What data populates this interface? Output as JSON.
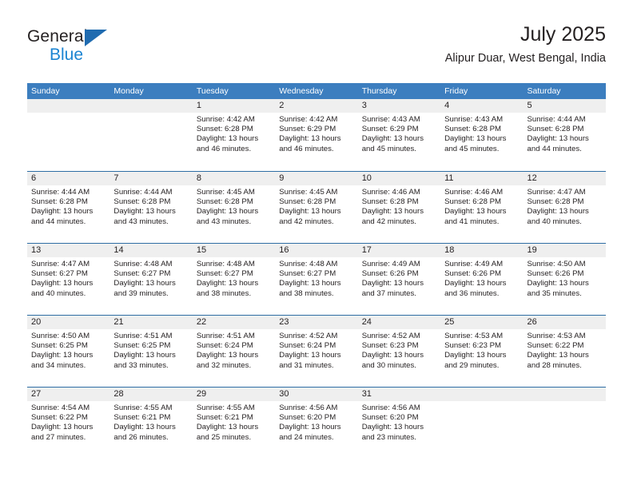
{
  "brand": {
    "name_top": "General",
    "name_bottom": "Blue"
  },
  "header": {
    "title": "July 2025",
    "subtitle": "Alipur Duar, West Bengal, India"
  },
  "calendar": {
    "weekdays": [
      "Sunday",
      "Monday",
      "Tuesday",
      "Wednesday",
      "Thursday",
      "Friday",
      "Saturday"
    ],
    "colors": {
      "header_blue": "#3c7ebf",
      "row_divider_blue": "#2e6da4",
      "day_band_gray": "#efefef",
      "brand_blue": "#1b84d2",
      "triangle_blue": "#1f6bb0",
      "text": "#231f20"
    },
    "weeks": [
      [
        {
          "day": "",
          "sunrise": "",
          "sunset": "",
          "daylight_1": "",
          "daylight_2": ""
        },
        {
          "day": "",
          "sunrise": "",
          "sunset": "",
          "daylight_1": "",
          "daylight_2": ""
        },
        {
          "day": "1",
          "sunrise": "Sunrise: 4:42 AM",
          "sunset": "Sunset: 6:28 PM",
          "daylight_1": "Daylight: 13 hours",
          "daylight_2": "and 46 minutes."
        },
        {
          "day": "2",
          "sunrise": "Sunrise: 4:42 AM",
          "sunset": "Sunset: 6:29 PM",
          "daylight_1": "Daylight: 13 hours",
          "daylight_2": "and 46 minutes."
        },
        {
          "day": "3",
          "sunrise": "Sunrise: 4:43 AM",
          "sunset": "Sunset: 6:29 PM",
          "daylight_1": "Daylight: 13 hours",
          "daylight_2": "and 45 minutes."
        },
        {
          "day": "4",
          "sunrise": "Sunrise: 4:43 AM",
          "sunset": "Sunset: 6:28 PM",
          "daylight_1": "Daylight: 13 hours",
          "daylight_2": "and 45 minutes."
        },
        {
          "day": "5",
          "sunrise": "Sunrise: 4:44 AM",
          "sunset": "Sunset: 6:28 PM",
          "daylight_1": "Daylight: 13 hours",
          "daylight_2": "and 44 minutes."
        }
      ],
      [
        {
          "day": "6",
          "sunrise": "Sunrise: 4:44 AM",
          "sunset": "Sunset: 6:28 PM",
          "daylight_1": "Daylight: 13 hours",
          "daylight_2": "and 44 minutes."
        },
        {
          "day": "7",
          "sunrise": "Sunrise: 4:44 AM",
          "sunset": "Sunset: 6:28 PM",
          "daylight_1": "Daylight: 13 hours",
          "daylight_2": "and 43 minutes."
        },
        {
          "day": "8",
          "sunrise": "Sunrise: 4:45 AM",
          "sunset": "Sunset: 6:28 PM",
          "daylight_1": "Daylight: 13 hours",
          "daylight_2": "and 43 minutes."
        },
        {
          "day": "9",
          "sunrise": "Sunrise: 4:45 AM",
          "sunset": "Sunset: 6:28 PM",
          "daylight_1": "Daylight: 13 hours",
          "daylight_2": "and 42 minutes."
        },
        {
          "day": "10",
          "sunrise": "Sunrise: 4:46 AM",
          "sunset": "Sunset: 6:28 PM",
          "daylight_1": "Daylight: 13 hours",
          "daylight_2": "and 42 minutes."
        },
        {
          "day": "11",
          "sunrise": "Sunrise: 4:46 AM",
          "sunset": "Sunset: 6:28 PM",
          "daylight_1": "Daylight: 13 hours",
          "daylight_2": "and 41 minutes."
        },
        {
          "day": "12",
          "sunrise": "Sunrise: 4:47 AM",
          "sunset": "Sunset: 6:28 PM",
          "daylight_1": "Daylight: 13 hours",
          "daylight_2": "and 40 minutes."
        }
      ],
      [
        {
          "day": "13",
          "sunrise": "Sunrise: 4:47 AM",
          "sunset": "Sunset: 6:27 PM",
          "daylight_1": "Daylight: 13 hours",
          "daylight_2": "and 40 minutes."
        },
        {
          "day": "14",
          "sunrise": "Sunrise: 4:48 AM",
          "sunset": "Sunset: 6:27 PM",
          "daylight_1": "Daylight: 13 hours",
          "daylight_2": "and 39 minutes."
        },
        {
          "day": "15",
          "sunrise": "Sunrise: 4:48 AM",
          "sunset": "Sunset: 6:27 PM",
          "daylight_1": "Daylight: 13 hours",
          "daylight_2": "and 38 minutes."
        },
        {
          "day": "16",
          "sunrise": "Sunrise: 4:48 AM",
          "sunset": "Sunset: 6:27 PM",
          "daylight_1": "Daylight: 13 hours",
          "daylight_2": "and 38 minutes."
        },
        {
          "day": "17",
          "sunrise": "Sunrise: 4:49 AM",
          "sunset": "Sunset: 6:26 PM",
          "daylight_1": "Daylight: 13 hours",
          "daylight_2": "and 37 minutes."
        },
        {
          "day": "18",
          "sunrise": "Sunrise: 4:49 AM",
          "sunset": "Sunset: 6:26 PM",
          "daylight_1": "Daylight: 13 hours",
          "daylight_2": "and 36 minutes."
        },
        {
          "day": "19",
          "sunrise": "Sunrise: 4:50 AM",
          "sunset": "Sunset: 6:26 PM",
          "daylight_1": "Daylight: 13 hours",
          "daylight_2": "and 35 minutes."
        }
      ],
      [
        {
          "day": "20",
          "sunrise": "Sunrise: 4:50 AM",
          "sunset": "Sunset: 6:25 PM",
          "daylight_1": "Daylight: 13 hours",
          "daylight_2": "and 34 minutes."
        },
        {
          "day": "21",
          "sunrise": "Sunrise: 4:51 AM",
          "sunset": "Sunset: 6:25 PM",
          "daylight_1": "Daylight: 13 hours",
          "daylight_2": "and 33 minutes."
        },
        {
          "day": "22",
          "sunrise": "Sunrise: 4:51 AM",
          "sunset": "Sunset: 6:24 PM",
          "daylight_1": "Daylight: 13 hours",
          "daylight_2": "and 32 minutes."
        },
        {
          "day": "23",
          "sunrise": "Sunrise: 4:52 AM",
          "sunset": "Sunset: 6:24 PM",
          "daylight_1": "Daylight: 13 hours",
          "daylight_2": "and 31 minutes."
        },
        {
          "day": "24",
          "sunrise": "Sunrise: 4:52 AM",
          "sunset": "Sunset: 6:23 PM",
          "daylight_1": "Daylight: 13 hours",
          "daylight_2": "and 30 minutes."
        },
        {
          "day": "25",
          "sunrise": "Sunrise: 4:53 AM",
          "sunset": "Sunset: 6:23 PM",
          "daylight_1": "Daylight: 13 hours",
          "daylight_2": "and 29 minutes."
        },
        {
          "day": "26",
          "sunrise": "Sunrise: 4:53 AM",
          "sunset": "Sunset: 6:22 PM",
          "daylight_1": "Daylight: 13 hours",
          "daylight_2": "and 28 minutes."
        }
      ],
      [
        {
          "day": "27",
          "sunrise": "Sunrise: 4:54 AM",
          "sunset": "Sunset: 6:22 PM",
          "daylight_1": "Daylight: 13 hours",
          "daylight_2": "and 27 minutes."
        },
        {
          "day": "28",
          "sunrise": "Sunrise: 4:55 AM",
          "sunset": "Sunset: 6:21 PM",
          "daylight_1": "Daylight: 13 hours",
          "daylight_2": "and 26 minutes."
        },
        {
          "day": "29",
          "sunrise": "Sunrise: 4:55 AM",
          "sunset": "Sunset: 6:21 PM",
          "daylight_1": "Daylight: 13 hours",
          "daylight_2": "and 25 minutes."
        },
        {
          "day": "30",
          "sunrise": "Sunrise: 4:56 AM",
          "sunset": "Sunset: 6:20 PM",
          "daylight_1": "Daylight: 13 hours",
          "daylight_2": "and 24 minutes."
        },
        {
          "day": "31",
          "sunrise": "Sunrise: 4:56 AM",
          "sunset": "Sunset: 6:20 PM",
          "daylight_1": "Daylight: 13 hours",
          "daylight_2": "and 23 minutes."
        },
        {
          "day": "",
          "sunrise": "",
          "sunset": "",
          "daylight_1": "",
          "daylight_2": ""
        },
        {
          "day": "",
          "sunrise": "",
          "sunset": "",
          "daylight_1": "",
          "daylight_2": ""
        }
      ]
    ]
  }
}
